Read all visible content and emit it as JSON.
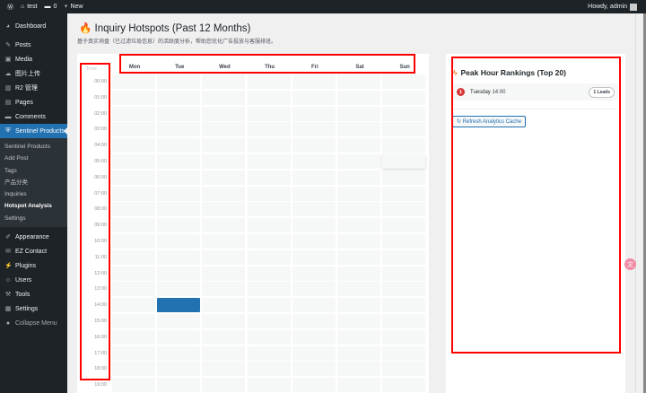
{
  "topbar": {
    "site": "test",
    "comments": "0",
    "new": "New",
    "howdy": "Howdy, admin"
  },
  "sidebar": {
    "items": [
      {
        "label": "Dashboard",
        "icon": "dashboard-icon",
        "glyph": "◕"
      },
      {
        "label": "Posts",
        "icon": "pin-icon",
        "glyph": "✎"
      },
      {
        "label": "Media",
        "icon": "media-icon",
        "glyph": "▣"
      },
      {
        "label": "图片上传",
        "icon": "cloud-icon",
        "glyph": "☁"
      },
      {
        "label": "R2 管理",
        "icon": "chart-icon",
        "glyph": "▥"
      },
      {
        "label": "Pages",
        "icon": "pages-icon",
        "glyph": "▤"
      },
      {
        "label": "Comments",
        "icon": "comment-icon",
        "glyph": "▬"
      }
    ],
    "active": {
      "label": "Sentinel Products",
      "icon": "shield-icon",
      "glyph": "⛨"
    },
    "submenu": [
      "Sentinel Products",
      "Add Post",
      "Tags",
      "产品分类",
      "Inquiries",
      "Hotspot Analysis",
      "Settings"
    ],
    "items2": [
      {
        "label": "Appearance",
        "icon": "brush-icon",
        "glyph": "✐"
      },
      {
        "label": "EZ Contact",
        "icon": "mail-icon",
        "glyph": "✉"
      },
      {
        "label": "Plugins",
        "icon": "plugin-icon",
        "glyph": "⚡"
      },
      {
        "label": "Users",
        "icon": "users-icon",
        "glyph": "☺"
      },
      {
        "label": "Tools",
        "icon": "wrench-icon",
        "glyph": "⚒"
      },
      {
        "label": "Settings",
        "icon": "settings-icon",
        "glyph": "▦"
      },
      {
        "label": "Collapse Menu",
        "icon": "collapse-icon",
        "glyph": "●"
      }
    ]
  },
  "page": {
    "title": "Inquiry Hotspots (Past 12 Months)",
    "subtitle": "基于真实询盘（已过滤垃圾信息）的活跃度分析，帮助您优化广告投放与客服排班。"
  },
  "heatmap": {
    "time_header": "Time",
    "days": [
      "Mon",
      "Tue",
      "Wed",
      "Thu",
      "Fri",
      "Sat",
      "Sun"
    ],
    "hours": [
      "00:00",
      "01:00",
      "02:00",
      "03:00",
      "04:00",
      "05:00",
      "06:00",
      "07:00",
      "08:00",
      "09:00",
      "10:00",
      "11:00",
      "12:00",
      "13:00",
      "14:00",
      "15:00",
      "16:00",
      "17:00",
      "18:00",
      "19:00"
    ],
    "hot": [
      {
        "day": "Tue",
        "hour": "14:00",
        "leads": 1
      }
    ],
    "hot_color": "#2271b1"
  },
  "rankings": {
    "title": "Peak Hour Rankings (Top 20)",
    "items": [
      {
        "rank": "1",
        "day": "Tuesday",
        "time": "14:00",
        "leads": "1 Leads"
      }
    ],
    "refresh": "Refresh Analytics Cache"
  }
}
